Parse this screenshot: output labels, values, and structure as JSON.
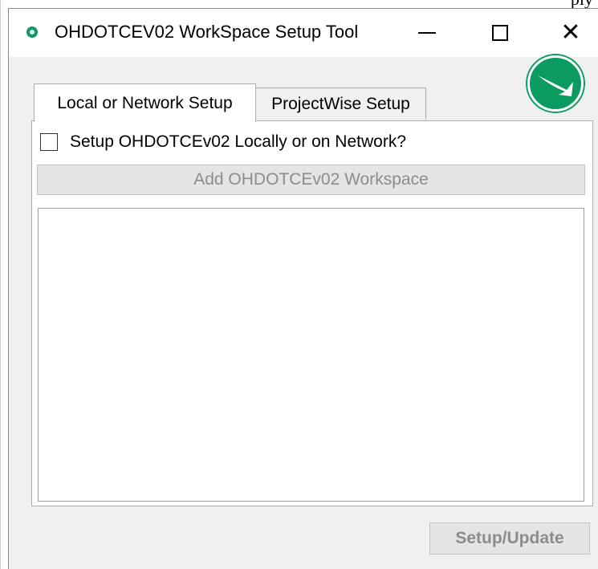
{
  "window": {
    "title": "OHDOTCEV02 WorkSpace Setup Tool",
    "close_glyph": "✕",
    "accent_color": "#0b9a60"
  },
  "tabs": [
    {
      "label": "Local or Network Setup",
      "selected": true
    },
    {
      "label": "ProjectWise Setup",
      "selected": false
    }
  ],
  "local_setup": {
    "checkbox_label": "Setup OHDOTCEv02 Locally or on Network?",
    "checkbox_checked": false,
    "add_button_label": "Add OHDOTCEv02 Workspace",
    "add_button_enabled": false
  },
  "footer": {
    "setup_button_label": "Setup/Update",
    "setup_button_enabled": false
  },
  "clipped_background_text": "ply"
}
